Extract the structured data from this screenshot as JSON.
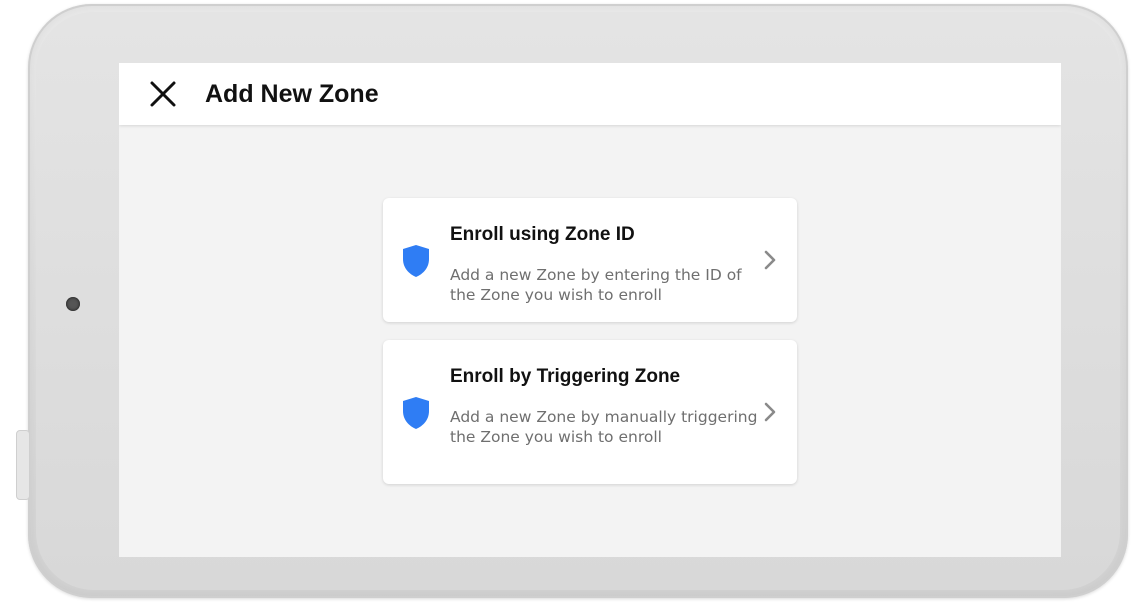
{
  "header": {
    "title": "Add New Zone",
    "close_icon": "close-icon"
  },
  "options": [
    {
      "title": "Enroll using Zone ID",
      "description": "Add a new Zone by entering the ID of the Zone you wish to enroll",
      "icon": "shield-icon"
    },
    {
      "title": "Enroll by Triggering Zone",
      "description": "Add a new Zone by manually triggering the Zone you wish to enroll",
      "icon": "shield-icon"
    }
  ],
  "colors": {
    "accent": "#2f7df4",
    "screen_background": "#f3f3f3",
    "card_background": "#ffffff",
    "description_text": "#6f6f6f",
    "chevron": "#8a8a8a"
  }
}
